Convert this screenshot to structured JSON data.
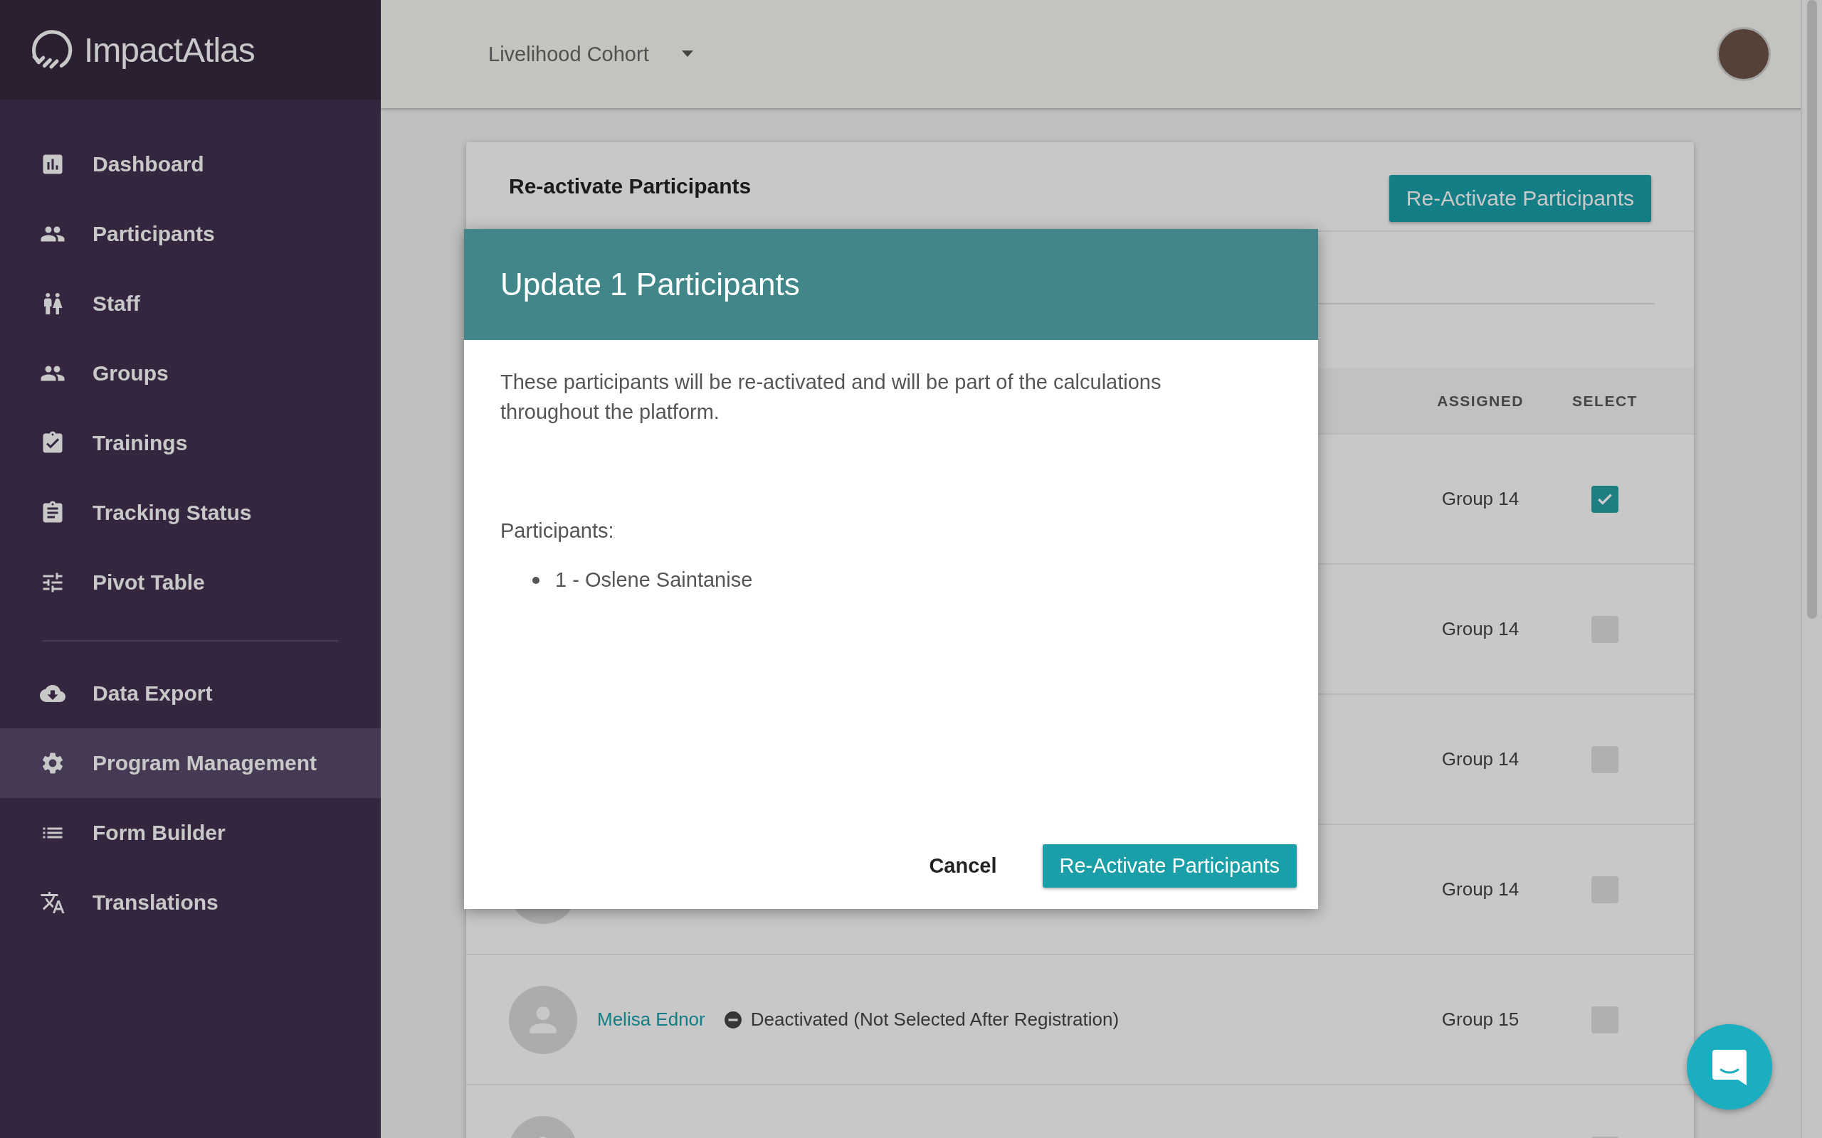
{
  "app": {
    "logo_text": "ImpactAtlas"
  },
  "sidebar": {
    "sections": [
      {
        "items": [
          {
            "label": "Dashboard",
            "selected": false
          },
          {
            "label": "Participants",
            "selected": false
          },
          {
            "label": "Staff",
            "selected": false
          },
          {
            "label": "Groups",
            "selected": false
          },
          {
            "label": "Trainings",
            "selected": false
          },
          {
            "label": "Tracking Status",
            "selected": false
          },
          {
            "label": "Pivot Table",
            "selected": false
          }
        ]
      },
      {
        "items": [
          {
            "label": "Data Export",
            "selected": false
          },
          {
            "label": "Program Management",
            "selected": true
          },
          {
            "label": "Form Builder",
            "selected": false
          },
          {
            "label": "Translations",
            "selected": false
          }
        ]
      }
    ]
  },
  "header": {
    "cohort": "Livelihood Cohort"
  },
  "card": {
    "title": "Re-activate Participants",
    "action": "Re-Activate Participants",
    "columns": [
      "ASSIGNED",
      "SELECT"
    ],
    "rows": [
      {
        "group": "Group 14",
        "selected": true
      },
      {
        "group": "Group 14",
        "selected": false
      },
      {
        "group": "Group 14",
        "selected": false
      },
      {
        "group": "Group 14",
        "selected": false
      },
      {
        "name": "Melisa Ednor",
        "status": "Deactivated (Not Selected After Registration)",
        "group": "Group 15",
        "selected": false
      },
      {
        "selected": false
      }
    ]
  },
  "dialog": {
    "title": "Update 1 Participants",
    "message": "These participants will be re-activated and will be part of the calculations throughout the platform.",
    "list_label": "Participants:",
    "participants": [
      "1 - Oslene Saintanise"
    ],
    "buttons": [
      {
        "label": "Cancel",
        "kind": "text"
      },
      {
        "label": "Re-Activate Participants",
        "kind": "primary"
      }
    ]
  }
}
